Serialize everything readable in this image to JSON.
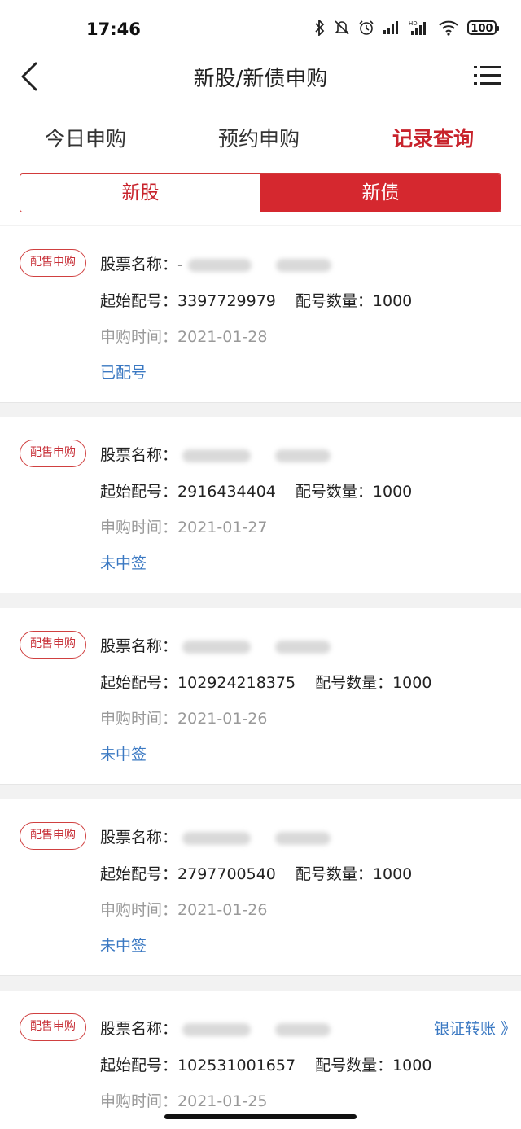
{
  "status_bar": {
    "time": "17:46",
    "battery": "100",
    "icons": [
      "bluetooth-icon",
      "bell-muted-icon",
      "alarm-icon",
      "signal-icon",
      "hd-signal-icon",
      "wifi-icon",
      "battery-icon"
    ]
  },
  "nav": {
    "title": "新股/新债申购",
    "back_icon": "back-arrow-icon",
    "menu_icon": "menu-list-icon"
  },
  "tabs": [
    "今日申购",
    "预约申购",
    "记录查询"
  ],
  "active_tab": "记录查询",
  "segment": {
    "left": "新股",
    "right": "新债",
    "active": "新债"
  },
  "labels": {
    "badge": "配售申购",
    "name_label": "股票名称：",
    "start_label": "起始配号：",
    "count_label": "配号数量：",
    "time_label": "申购时间：",
    "transfer": "银证转账 》"
  },
  "records": [
    {
      "name_prefix": "-",
      "start_no": "3397729979",
      "count": "1000",
      "date": "2021-01-28",
      "status": "已配号"
    },
    {
      "name_prefix": "",
      "start_no": "2916434404",
      "count": "1000",
      "date": "2021-01-27",
      "status": "未中签"
    },
    {
      "name_prefix": "",
      "start_no": "102924218375",
      "count": "1000",
      "date": "2021-01-26",
      "status": "未中签"
    },
    {
      "name_prefix": "",
      "start_no": "2797700540",
      "count": "1000",
      "date": "2021-01-26",
      "status": "未中签"
    },
    {
      "name_prefix": "",
      "start_no": "102531001657",
      "count": "1000",
      "date": "2021-01-25",
      "status": ""
    }
  ],
  "colors": {
    "accent": "#c8232c",
    "segment_active_bg": "#d5282f",
    "link": "#3a78c2",
    "muted": "#999999",
    "background": "#f2f2f2"
  }
}
